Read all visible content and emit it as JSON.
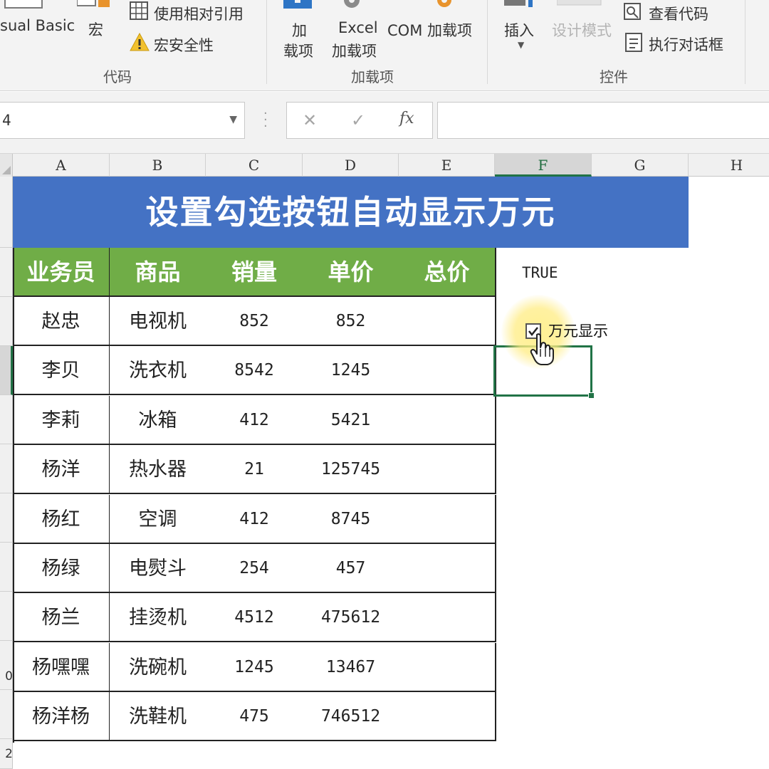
{
  "ribbon": {
    "visual_basic": "sual Basic",
    "macro": "宏",
    "relative_ref": "使用相对引用",
    "macro_security": "宏安全性",
    "code_group": "代码",
    "addins_line1": "加",
    "addins_line2": "载项",
    "excel_addins_line1": "Excel",
    "excel_addins_line2": "加载项",
    "com_addins": "COM 加载项",
    "addins_group": "加载项",
    "insert": "插入",
    "design_mode": "设计模式",
    "view_code": "查看代码",
    "run_dialog": "执行对话框",
    "controls_group": "控件"
  },
  "formula_bar": {
    "name_box": "4",
    "cancel_symbol": "✕",
    "enter_symbol": "✓",
    "fx_symbol": "fx",
    "content": ""
  },
  "columns": [
    "A",
    "B",
    "C",
    "D",
    "E",
    "F",
    "G",
    "H"
  ],
  "selected_column": "F",
  "row_numbers": [
    "0",
    "2"
  ],
  "sheet": {
    "title": "设置勾选按钮自动显示万元",
    "headers": [
      "业务员",
      "商品",
      "销量",
      "单价",
      "总价"
    ],
    "rows": [
      [
        "赵忠",
        "电视机",
        "852",
        "852",
        ""
      ],
      [
        "李贝",
        "洗衣机",
        "8542",
        "1245",
        ""
      ],
      [
        "李莉",
        "冰箱",
        "412",
        "5421",
        ""
      ],
      [
        "杨洋",
        "热水器",
        "21",
        "125745",
        ""
      ],
      [
        "杨红",
        "空调",
        "412",
        "8745",
        ""
      ],
      [
        "杨绿",
        "电熨斗",
        "254",
        "457",
        ""
      ],
      [
        "杨兰",
        "挂烫机",
        "4512",
        "475612",
        ""
      ],
      [
        "杨嘿嘿",
        "洗碗机",
        "1245",
        "13467",
        ""
      ],
      [
        "杨洋杨",
        "洗鞋机",
        "475",
        "746512",
        ""
      ]
    ],
    "linked_value": "TRUE",
    "checkbox_label": "万元显示",
    "checkbox_checked": true
  },
  "colors": {
    "title_bg": "#4472c4",
    "header_bg": "#70ad47",
    "excel_green": "#217346"
  }
}
